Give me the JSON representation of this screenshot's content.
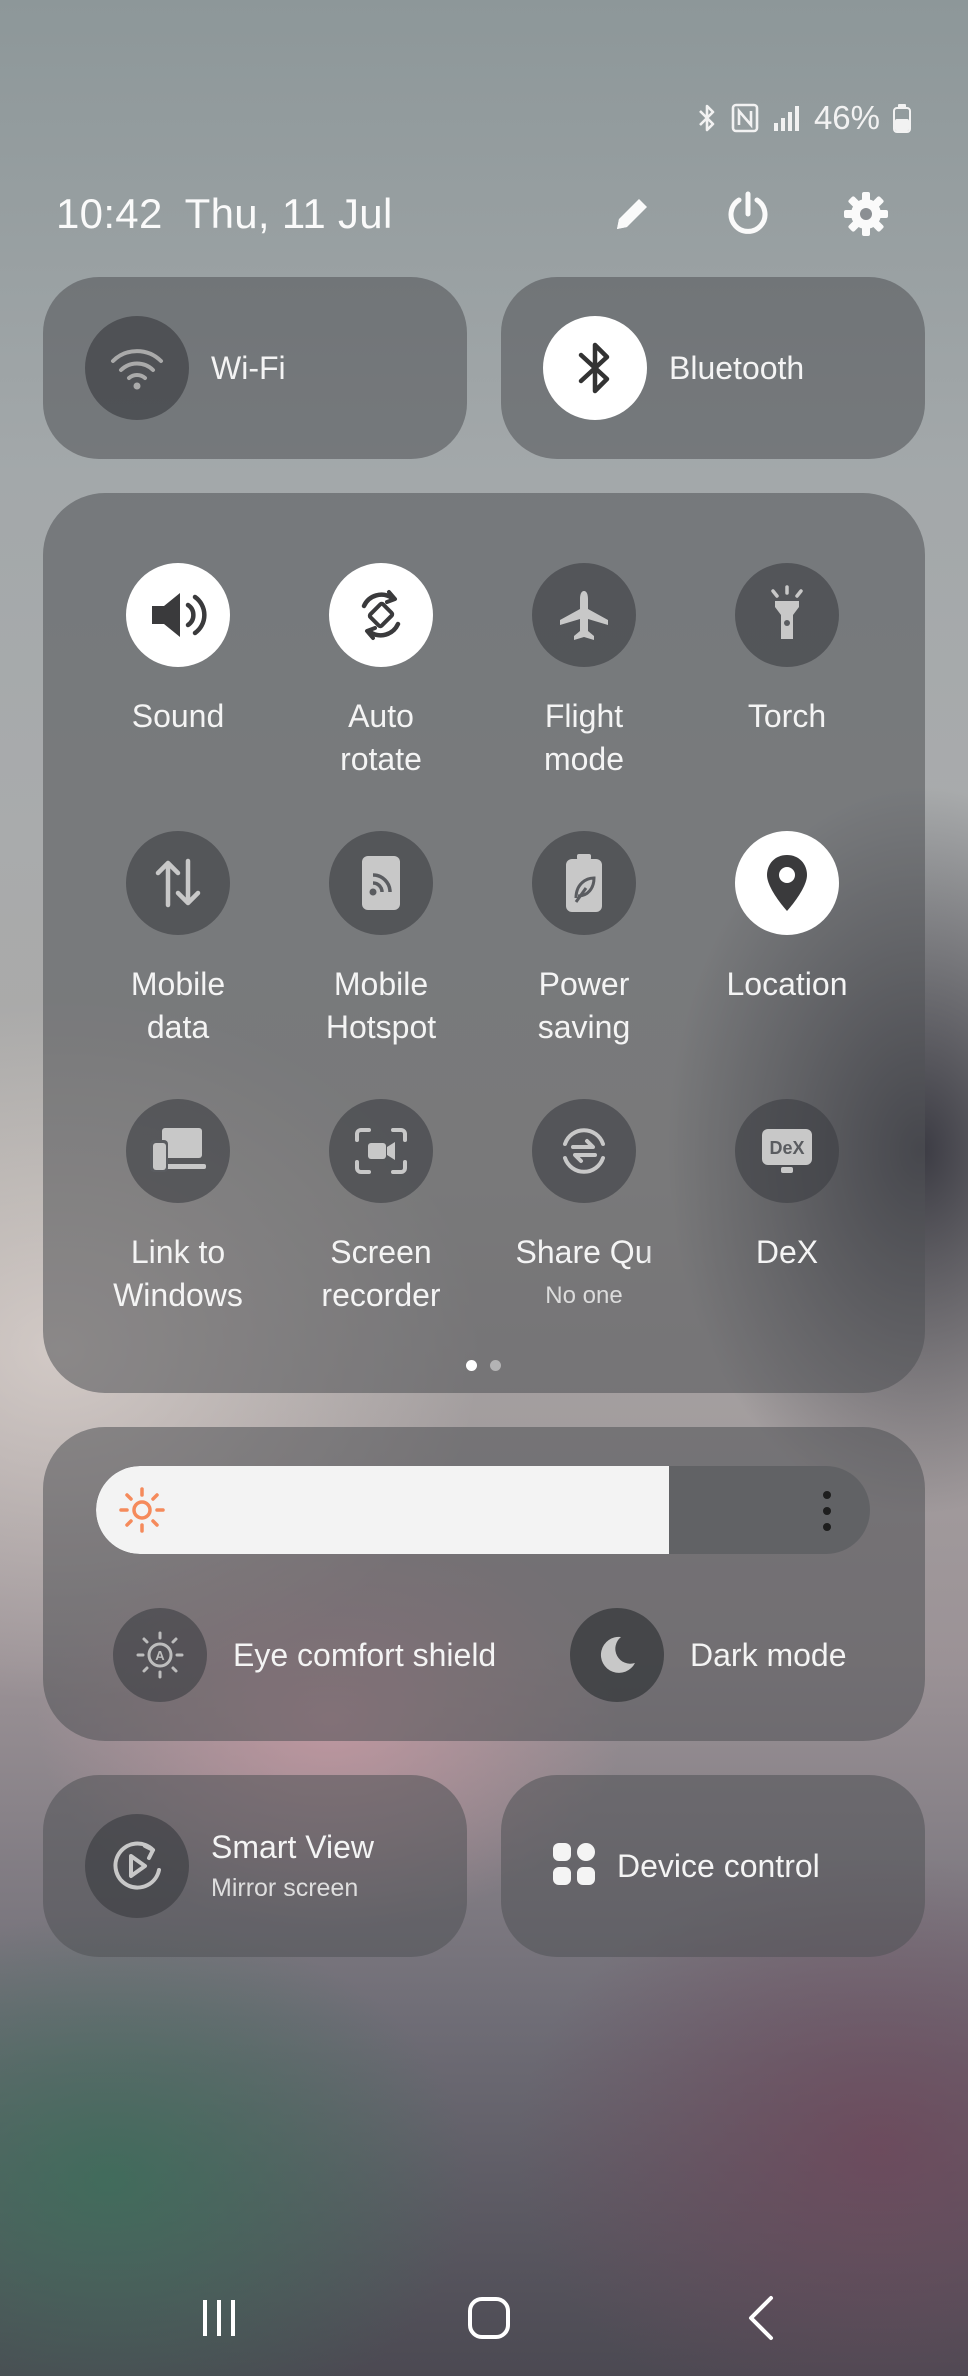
{
  "status_bar": {
    "battery": "46%",
    "icons": [
      "bluetooth-icon",
      "nfc-icon",
      "signal-icon",
      "battery-icon"
    ]
  },
  "header": {
    "time": "10:42",
    "date": "Thu, 11 Jul"
  },
  "connectivity": {
    "wifi": {
      "label": "Wi-Fi",
      "active": false
    },
    "bluetooth": {
      "label": "Bluetooth",
      "active": true
    }
  },
  "tiles": [
    {
      "label": "Sound",
      "active": true
    },
    {
      "label": "Auto\nrotate",
      "active": true
    },
    {
      "label": "Flight\nmode",
      "active": false
    },
    {
      "label": "Torch",
      "active": false
    },
    {
      "label": "Mobile\ndata",
      "active": false
    },
    {
      "label": "Mobile\nHotspot",
      "active": false
    },
    {
      "label": "Power\nsaving",
      "active": false
    },
    {
      "label": "Location",
      "active": true
    },
    {
      "label": "Link to\nWindows",
      "active": false
    },
    {
      "label": "Screen\nrecorder",
      "active": false
    },
    {
      "label": "Share Qu",
      "sub": "No one",
      "active": false
    },
    {
      "label": "DeX",
      "active": false
    }
  ],
  "page_indicator": {
    "pages": 2,
    "current": 1
  },
  "brightness": {
    "level": 0.74
  },
  "display_toggles": {
    "eye_comfort": "Eye comfort shield",
    "dark_mode": "Dark mode"
  },
  "bottom": {
    "smart_view": {
      "label": "Smart View",
      "sub": "Mirror screen"
    },
    "device_control": {
      "label": "Device control"
    }
  },
  "colors": {
    "accent_sun": "#f58a5b",
    "active_bg": "#ffffff",
    "active_icon": "#3a3a3c"
  }
}
